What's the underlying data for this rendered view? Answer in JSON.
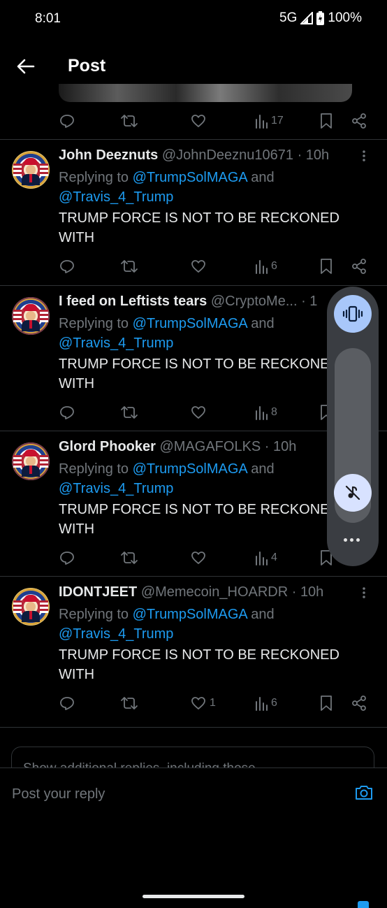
{
  "status_bar": {
    "time": "8:01",
    "network": "5G",
    "battery": "100%"
  },
  "header": {
    "title": "Post"
  },
  "top_tweet_actions": {
    "views": "17"
  },
  "replies": [
    {
      "display_name": "John Deeznuts",
      "handle_time": "@JohnDeeznu10671 · 10h",
      "replying_prefix": "Replying to ",
      "mention_1": "@TrumpSolMAGA",
      "and": " and",
      "mention_2": "@Travis_4_Trump",
      "text": "TRUMP FORCE IS NOT TO BE RECKONED WITH",
      "likes": "",
      "views": "6"
    },
    {
      "display_name": "I feed on Leftists tears",
      "handle_time": "@CryptoMe... · 1",
      "replying_prefix": "Replying to ",
      "mention_1": "@TrumpSolMAGA",
      "and": " and",
      "mention_2": "@Travis_4_Trump",
      "text": "TRUMP FORCE IS NOT TO BE RECKONED WITH",
      "likes": "",
      "views": "8"
    },
    {
      "display_name": "Glord Phooker",
      "handle_time": "@MAGAFOLKS · 10h",
      "replying_prefix": "Replying to ",
      "mention_1": "@TrumpSolMAGA",
      "and": " and",
      "mention_2": "@Travis_4_Trump",
      "text": "TRUMP FORCE IS NOT TO BE RECKONED WITH",
      "likes": "",
      "views": "4"
    },
    {
      "display_name": "IDONTJEET",
      "handle_time": "@Memecoin_HOARDR · 10h",
      "replying_prefix": "Replying to ",
      "mention_1": "@TrumpSolMAGA",
      "and": " and",
      "mention_2": "@Travis_4_Trump",
      "text": "TRUMP FORCE IS NOT TO BE RECKONED WITH",
      "likes": "1",
      "views": "6"
    }
  ],
  "show_more": "Show additional replies, including those",
  "composer": {
    "placeholder": "Post your reply"
  },
  "colors": {
    "background": "#000000",
    "accent": "#1d9bf0",
    "muted": "#71767b",
    "volume_panel": "#3a3d42",
    "volume_active": "#a8c7fa"
  },
  "icons": [
    "back-arrow-icon",
    "reply-icon",
    "retweet-icon",
    "like-icon",
    "views-icon",
    "bookmark-icon",
    "share-icon",
    "more-icon",
    "camera-icon",
    "vibrate-icon",
    "mute-icon"
  ]
}
